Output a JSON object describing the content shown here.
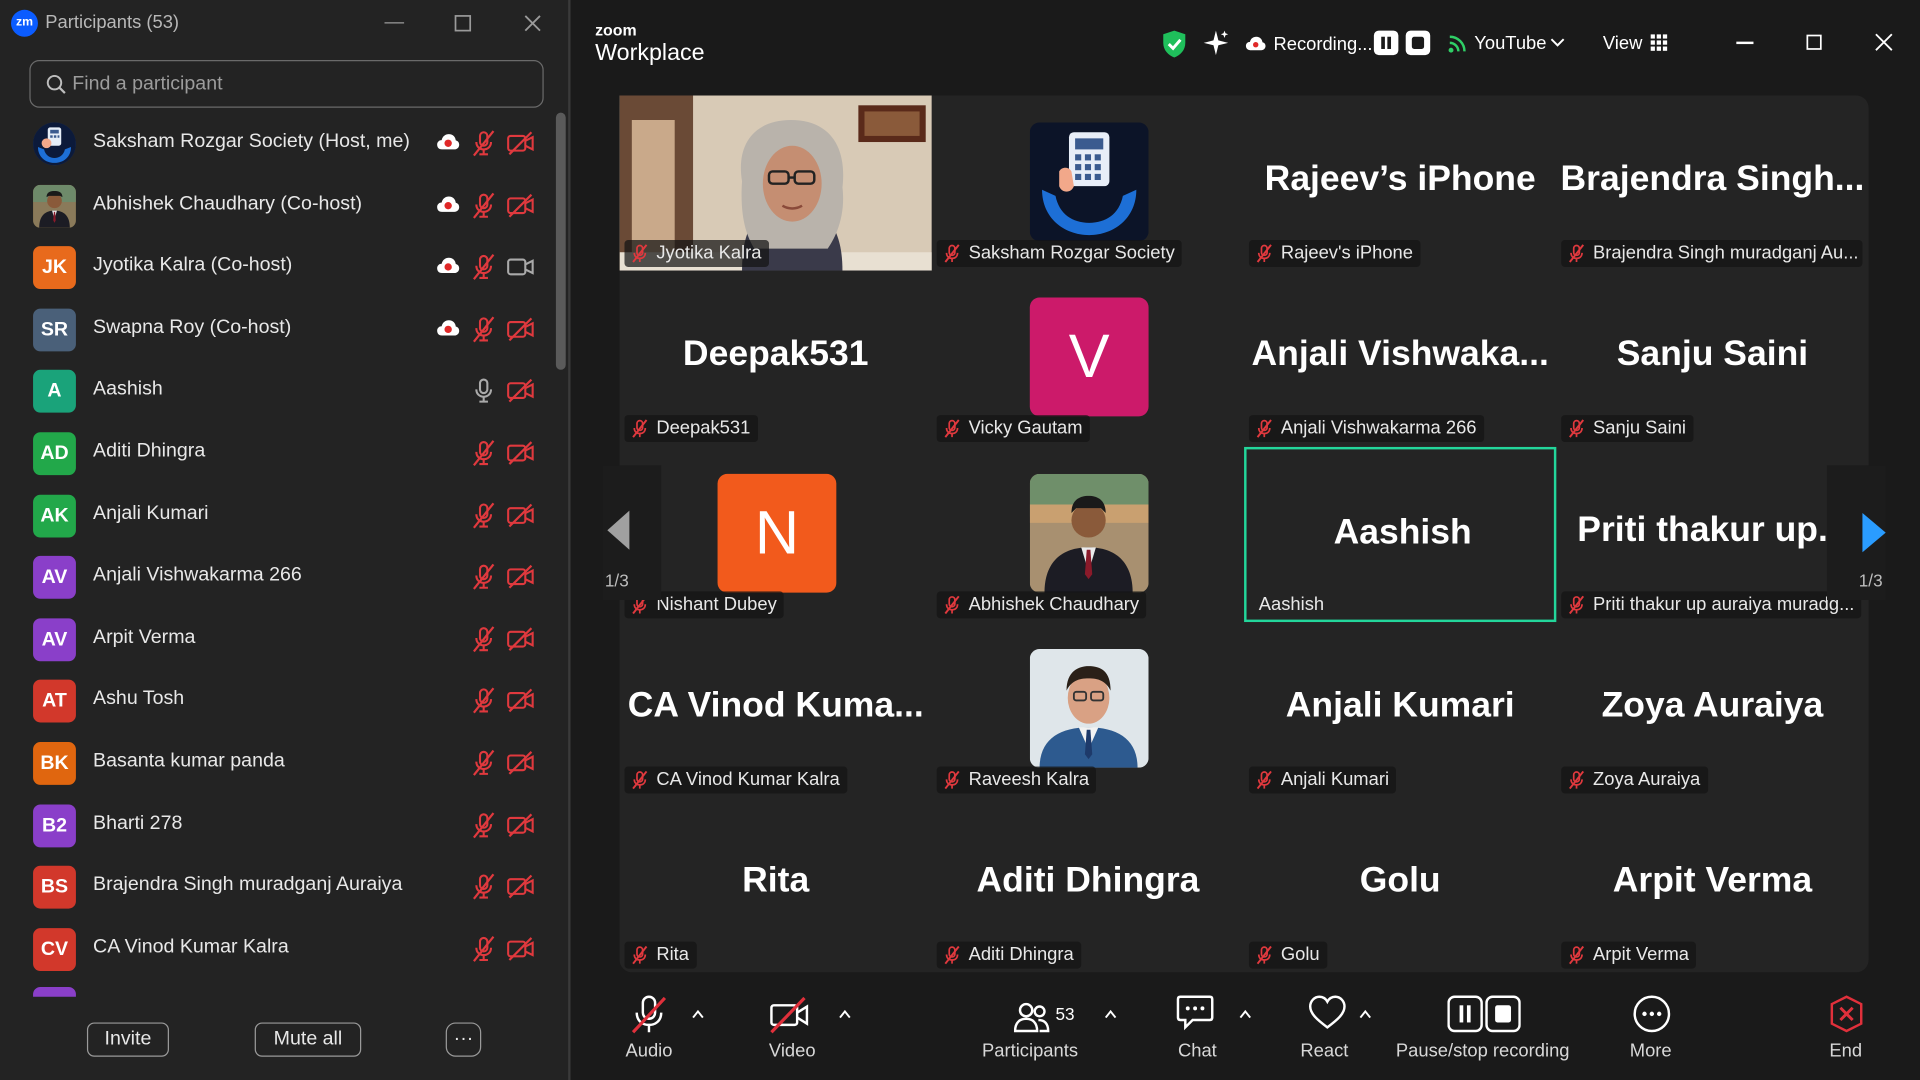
{
  "panel": {
    "title": "Participants (53)",
    "search_placeholder": "Find a participant",
    "participants": [
      {
        "name": "Saksham Rozgar Society (Host, me)",
        "initials": "",
        "color": "#1b3a7a",
        "cloud": true,
        "video": "off"
      },
      {
        "name": "Abhishek Chaudhary (Co-host)",
        "initials": "",
        "color": "#6b5a3a",
        "cloud": true,
        "video": "off"
      },
      {
        "name": "Jyotika Kalra (Co-host)",
        "initials": "JK",
        "color": "#e86a1c",
        "cloud": true,
        "video": "on"
      },
      {
        "name": "Swapna Roy (Co-host)",
        "initials": "SR",
        "color": "#4a6079",
        "cloud": true,
        "video": "off"
      },
      {
        "name": "Aashish",
        "initials": "A",
        "color": "#1aa37a",
        "cloud": false,
        "mic": "on",
        "video": "off"
      },
      {
        "name": "Aditi Dhingra",
        "initials": "AD",
        "color": "#22a84a",
        "cloud": false,
        "video": "off"
      },
      {
        "name": "Anjali Kumari",
        "initials": "AK",
        "color": "#22a84a",
        "cloud": false,
        "video": "off"
      },
      {
        "name": "Anjali Vishwakarma 266",
        "initials": "AV",
        "color": "#8a3fc9",
        "cloud": false,
        "video": "off"
      },
      {
        "name": "Arpit Verma",
        "initials": "AV",
        "color": "#8a3fc9",
        "cloud": false,
        "video": "off"
      },
      {
        "name": "Ashu Tosh",
        "initials": "AT",
        "color": "#d2382b",
        "cloud": false,
        "video": "off"
      },
      {
        "name": "Basanta kumar panda",
        "initials": "BK",
        "color": "#e0660f",
        "cloud": false,
        "video": "off"
      },
      {
        "name": "Bharti 278",
        "initials": "B2",
        "color": "#8a3fc9",
        "cloud": false,
        "video": "off"
      },
      {
        "name": "Brajendra Singh muradganj Auraiya",
        "initials": "BS",
        "color": "#d2382b",
        "cloud": false,
        "video": "off"
      },
      {
        "name": "CA Vinod Kumar Kalra",
        "initials": "CV",
        "color": "#d2382b",
        "cloud": false,
        "video": "off"
      }
    ],
    "invite_label": "Invite",
    "mute_all_label": "Mute all",
    "more_label": "···"
  },
  "meeting": {
    "brand_small": "zoom",
    "brand_big": "Workplace",
    "recording_label": "Recording...",
    "youtube_label": "YouTube",
    "view_label": "View",
    "page_indicator_left": "1/3",
    "page_indicator_right": "1/3",
    "tiles": [
      {
        "type": "video",
        "label": "Jyotika Kalra"
      },
      {
        "type": "avatar-logo",
        "label": "Saksham Rozgar Society"
      },
      {
        "type": "name",
        "big": "Rajeev’s iPhone",
        "label": "Rajeev's iPhone"
      },
      {
        "type": "name",
        "big": "Brajendra  Singh...",
        "label": "Brajendra Singh muradganj Au..."
      },
      {
        "type": "name",
        "big": "Deepak531",
        "label": "Deepak531"
      },
      {
        "type": "letter",
        "letter": "V",
        "color": "#cc1a6a",
        "label": "Vicky Gautam"
      },
      {
        "type": "name",
        "big": "Anjali  Vishwaka...",
        "label": "Anjali Vishwakarma 266"
      },
      {
        "type": "name",
        "big": "Sanju Saini",
        "label": "Sanju Saini"
      },
      {
        "type": "letter",
        "letter": "N",
        "color": "#f25a1c",
        "label": "Nishant Dubey"
      },
      {
        "type": "photo-abhishek",
        "label": "Abhishek Chaudhary"
      },
      {
        "type": "name-active",
        "big": "Aashish",
        "label": "Aashish"
      },
      {
        "type": "name",
        "big": "Priti  thakur  up...",
        "label": "Priti thakur up auraiya muradg..."
      },
      {
        "type": "name",
        "big": "CA  Vinod  Kuma...",
        "label": "CA Vinod Kumar Kalra"
      },
      {
        "type": "photo-raveesh",
        "label": "Raveesh Kalra"
      },
      {
        "type": "name",
        "big": "Anjali Kumari",
        "label": "Anjali Kumari"
      },
      {
        "type": "name",
        "big": "Zoya Auraiya",
        "label": "Zoya Auraiya"
      },
      {
        "type": "name",
        "big": "Rita",
        "label": "Rita"
      },
      {
        "type": "name",
        "big": "Aditi Dhingra",
        "label": "Aditi Dhingra"
      },
      {
        "type": "name",
        "big": "Golu",
        "label": "Golu"
      },
      {
        "type": "name",
        "big": "Arpit Verma",
        "label": "Arpit Verma"
      }
    ]
  },
  "toolbar": {
    "audio_label": "Audio",
    "video_label": "Video",
    "participants_count": "53",
    "participants_label": "Participants",
    "chat_label": "Chat",
    "react_label": "React",
    "recording_label": "Pause/stop recording",
    "more_label": "More",
    "end_label": "End"
  }
}
